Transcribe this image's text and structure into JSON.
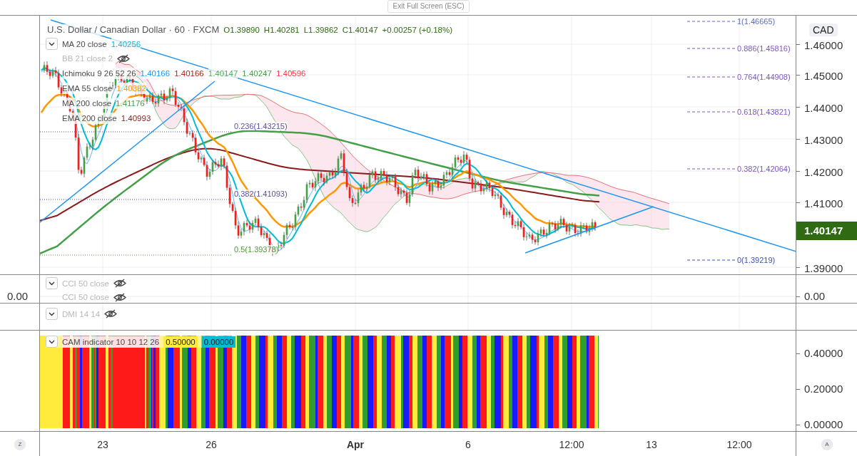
{
  "toolbar": {
    "exit_button": "Exit Full Screen (ESC)"
  },
  "symbol": {
    "title": "U.S. Dollar / Canadian Dollar · 60 · FXCM",
    "ohlc": [
      "O1.39890",
      "H1.40281",
      "L1.39862",
      "C1.40147"
    ],
    "change": "+0.00257 (+0.18%)"
  },
  "indicators": [
    {
      "name": "MA 20 close",
      "hidden": false,
      "collapse_button": true,
      "values": [
        {
          "text": "1.40256",
          "color": "#00bcd4"
        }
      ]
    },
    {
      "name": "BB 21 close 2",
      "hidden": true,
      "collapse_button": false
    },
    {
      "name": "Ichimoku 9 26 52 26",
      "hidden": false,
      "collapse_button": false,
      "values": [
        {
          "text": "1.40166",
          "color": "#2196f3"
        },
        {
          "text": "1.40166",
          "color": "#a52714"
        },
        {
          "text": "1.40147",
          "color": "#4caf50"
        },
        {
          "text": "1.40247",
          "color": "#43a047"
        },
        {
          "text": "1.40596",
          "color": "#f23645"
        }
      ]
    },
    {
      "name": "EMA 55 close",
      "hidden": false,
      "collapse_button": false,
      "values": [
        {
          "text": "1.40382",
          "color": "#ff9800"
        }
      ]
    },
    {
      "name": "MA 200 close",
      "hidden": false,
      "collapse_button": false,
      "values": [
        {
          "text": "1.41176",
          "color": "#43a047"
        }
      ]
    },
    {
      "name": "EMA 200 close",
      "hidden": false,
      "collapse_button": false,
      "values": [
        {
          "text": "1.40993",
          "color": "#8b1a1a"
        }
      ]
    }
  ],
  "fib_levels": [
    {
      "text": "1(1.46665)",
      "color": "#5c6bc0"
    },
    {
      "text": "0.886(1.45816)",
      "color": "#7e57c2"
    },
    {
      "text": "0.764(1.44908)",
      "color": "#7e57c2"
    },
    {
      "text": "0.618(1.43821)",
      "color": "#7e57c2"
    },
    {
      "text": "0.382(1.42064)",
      "color": "#7e57c2"
    },
    {
      "text": "0(1.39219)",
      "color": "#3f51b5"
    }
  ],
  "fib_levels_left": [
    {
      "text": "0.236(1.43215)",
      "color": "#5e4fa2"
    },
    {
      "text": "0.382(1.41093)",
      "color": "#5e4fa2"
    },
    {
      "text": "0.5(1.39378)",
      "color": "#4f9a3a"
    }
  ],
  "price_axis": {
    "currency": "CAD",
    "labels": [
      "1.46000",
      "1.45000",
      "1.44000",
      "1.43000",
      "1.42000",
      "1.41000",
      "1.39000"
    ],
    "last_price": "1.40147"
  },
  "cci_pane": {
    "legends": [
      {
        "name": "CCI 50 close",
        "hidden": true,
        "collapse_button": true
      },
      {
        "name": "CCI 50 close",
        "hidden": true,
        "collapse_button": false
      }
    ],
    "left_axis": "0.00",
    "right_axis": "0.00"
  },
  "dmi_pane": {
    "legends": [
      {
        "name": "DMI 14 14",
        "hidden": true,
        "collapse_button": true
      }
    ]
  },
  "cam_pane": {
    "legend": {
      "name": "CAM indicator 10 10 12 26",
      "collapse_button": true,
      "values": [
        {
          "text": "0.50000",
          "color": "#ffeb3b"
        },
        {
          "text": "0.00000",
          "color": "#00bcd4"
        }
      ]
    },
    "axis": [
      "0.40000",
      "0.20000",
      "0.00000"
    ]
  },
  "time_axis": {
    "left_button": "Z",
    "right_button": "A",
    "labels": [
      {
        "text": "23",
        "bold": false
      },
      {
        "text": "26",
        "bold": false
      },
      {
        "text": "Apr",
        "bold": true
      },
      {
        "text": "6",
        "bold": false
      },
      {
        "text": "12:00",
        "bold": false
      },
      {
        "text": "13",
        "bold": false
      },
      {
        "text": "12:00",
        "bold": false
      }
    ]
  }
}
